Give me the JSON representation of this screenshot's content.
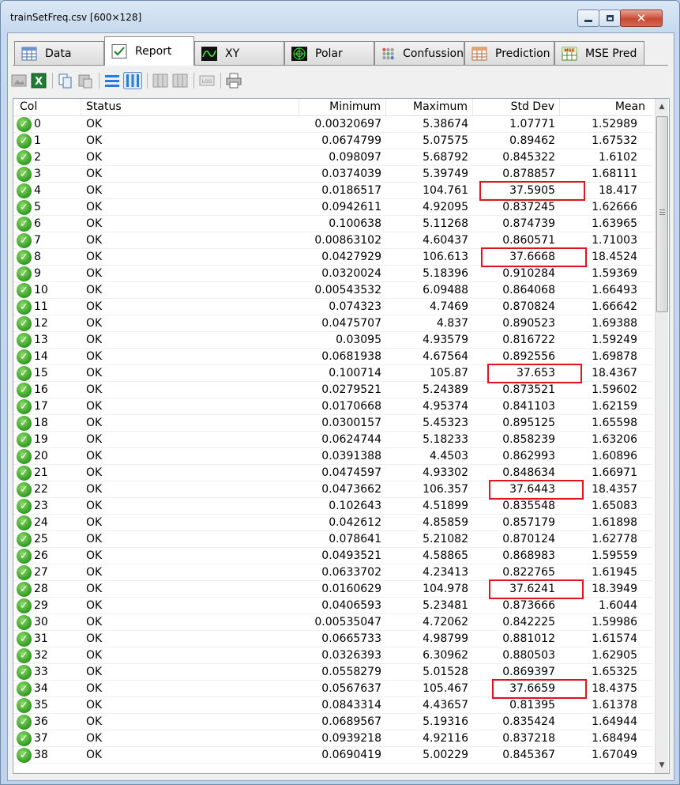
{
  "window": {
    "title": "trainSetFreq.csv [600×128]"
  },
  "tabs": [
    {
      "label": "Data",
      "icon": "data-grid-icon"
    },
    {
      "label": "Report",
      "icon": "checkbox-report-icon"
    },
    {
      "label": "XY",
      "icon": "xy-plot-icon"
    },
    {
      "label": "Polar",
      "icon": "polar-plot-icon"
    },
    {
      "label": "Confussion",
      "icon": "confusion-matrix-icon"
    },
    {
      "label": "Prediction",
      "icon": "prediction-grid-icon"
    },
    {
      "label": "MSE Pred",
      "icon": "mse-pred-icon"
    }
  ],
  "active_tab": "Report",
  "columns": {
    "col": "Col",
    "status": "Status",
    "minimum": "Minimum",
    "maximum": "Maximum",
    "std_dev": "Std Dev",
    "mean": "Mean"
  },
  "rows": [
    {
      "col": "0",
      "status": "OK",
      "min": "0.00320697",
      "max": "5.38674",
      "std": "1.07771",
      "mean": "1.52989"
    },
    {
      "col": "1",
      "status": "OK",
      "min": "0.0674799",
      "max": "5.07575",
      "std": "0.89462",
      "mean": "1.67532"
    },
    {
      "col": "2",
      "status": "OK",
      "min": "0.098097",
      "max": "5.68792",
      "std": "0.845322",
      "mean": "1.6102"
    },
    {
      "col": "3",
      "status": "OK",
      "min": "0.0374039",
      "max": "5.39749",
      "std": "0.878857",
      "mean": "1.68111"
    },
    {
      "col": "4",
      "status": "OK",
      "min": "0.0186517",
      "max": "104.761",
      "std": "37.5905",
      "mean": "18.417",
      "highlight": true
    },
    {
      "col": "5",
      "status": "OK",
      "min": "0.0942611",
      "max": "4.92095",
      "std": "0.837245",
      "mean": "1.62666"
    },
    {
      "col": "6",
      "status": "OK",
      "min": "0.100638",
      "max": "5.11268",
      "std": "0.874739",
      "mean": "1.63965"
    },
    {
      "col": "7",
      "status": "OK",
      "min": "0.00863102",
      "max": "4.60437",
      "std": "0.860571",
      "mean": "1.71003"
    },
    {
      "col": "8",
      "status": "OK",
      "min": "0.0427929",
      "max": "106.613",
      "std": "37.6668",
      "mean": "18.4524",
      "highlight": true
    },
    {
      "col": "9",
      "status": "OK",
      "min": "0.0320024",
      "max": "5.18396",
      "std": "0.910284",
      "mean": "1.59369"
    },
    {
      "col": "10",
      "status": "OK",
      "min": "0.00543532",
      "max": "6.09488",
      "std": "0.864068",
      "mean": "1.66493"
    },
    {
      "col": "11",
      "status": "OK",
      "min": "0.074323",
      "max": "4.7469",
      "std": "0.870824",
      "mean": "1.66642"
    },
    {
      "col": "12",
      "status": "OK",
      "min": "0.0475707",
      "max": "4.837",
      "std": "0.890523",
      "mean": "1.69388"
    },
    {
      "col": "13",
      "status": "OK",
      "min": "0.03095",
      "max": "4.93579",
      "std": "0.816722",
      "mean": "1.59249"
    },
    {
      "col": "14",
      "status": "OK",
      "min": "0.0681938",
      "max": "4.67564",
      "std": "0.892556",
      "mean": "1.69878"
    },
    {
      "col": "15",
      "status": "OK",
      "min": "0.100714",
      "max": "105.87",
      "std": "37.653",
      "mean": "18.4367",
      "highlight": true
    },
    {
      "col": "16",
      "status": "OK",
      "min": "0.0279521",
      "max": "5.24389",
      "std": "0.873521",
      "mean": "1.59602"
    },
    {
      "col": "17",
      "status": "OK",
      "min": "0.0170668",
      "max": "4.95374",
      "std": "0.841103",
      "mean": "1.62159"
    },
    {
      "col": "18",
      "status": "OK",
      "min": "0.0300157",
      "max": "5.45323",
      "std": "0.895125",
      "mean": "1.65598"
    },
    {
      "col": "19",
      "status": "OK",
      "min": "0.0624744",
      "max": "5.18233",
      "std": "0.858239",
      "mean": "1.63206"
    },
    {
      "col": "20",
      "status": "OK",
      "min": "0.0391388",
      "max": "4.4503",
      "std": "0.862993",
      "mean": "1.60896"
    },
    {
      "col": "21",
      "status": "OK",
      "min": "0.0474597",
      "max": "4.93302",
      "std": "0.848634",
      "mean": "1.66971"
    },
    {
      "col": "22",
      "status": "OK",
      "min": "0.0473662",
      "max": "106.357",
      "std": "37.6443",
      "mean": "18.4357",
      "highlight": true
    },
    {
      "col": "23",
      "status": "OK",
      "min": "0.102643",
      "max": "4.51899",
      "std": "0.835548",
      "mean": "1.65083"
    },
    {
      "col": "24",
      "status": "OK",
      "min": "0.042612",
      "max": "4.85859",
      "std": "0.857179",
      "mean": "1.61898"
    },
    {
      "col": "25",
      "status": "OK",
      "min": "0.078641",
      "max": "5.21082",
      "std": "0.870124",
      "mean": "1.62778"
    },
    {
      "col": "26",
      "status": "OK",
      "min": "0.0493521",
      "max": "4.58865",
      "std": "0.868983",
      "mean": "1.59559"
    },
    {
      "col": "27",
      "status": "OK",
      "min": "0.0633702",
      "max": "4.23413",
      "std": "0.822765",
      "mean": "1.61945"
    },
    {
      "col": "28",
      "status": "OK",
      "min": "0.0160629",
      "max": "104.978",
      "std": "37.6241",
      "mean": "18.3949",
      "highlight": true
    },
    {
      "col": "29",
      "status": "OK",
      "min": "0.0406593",
      "max": "5.23481",
      "std": "0.873666",
      "mean": "1.6044"
    },
    {
      "col": "30",
      "status": "OK",
      "min": "0.00535047",
      "max": "4.72062",
      "std": "0.842225",
      "mean": "1.59986"
    },
    {
      "col": "31",
      "status": "OK",
      "min": "0.0665733",
      "max": "4.98799",
      "std": "0.881012",
      "mean": "1.61574"
    },
    {
      "col": "32",
      "status": "OK",
      "min": "0.0326393",
      "max": "6.30962",
      "std": "0.880503",
      "mean": "1.62905"
    },
    {
      "col": "33",
      "status": "OK",
      "min": "0.0558279",
      "max": "5.01528",
      "std": "0.869397",
      "mean": "1.65325"
    },
    {
      "col": "34",
      "status": "OK",
      "min": "0.0567637",
      "max": "105.467",
      "std": "37.6659",
      "mean": "18.4375",
      "highlight": true
    },
    {
      "col": "35",
      "status": "OK",
      "min": "0.0843314",
      "max": "4.43657",
      "std": "0.81395",
      "mean": "1.61378"
    },
    {
      "col": "36",
      "status": "OK",
      "min": "0.0689567",
      "max": "5.19316",
      "std": "0.835424",
      "mean": "1.64944"
    },
    {
      "col": "37",
      "status": "OK",
      "min": "0.0939218",
      "max": "4.92116",
      "std": "0.837218",
      "mean": "1.68494"
    },
    {
      "col": "38",
      "status": "OK",
      "min": "0.0690419",
      "max": "5.00229",
      "std": "0.845367",
      "mean": "1.67049"
    }
  ],
  "colors": {
    "highlight_border": "#e0141c",
    "ok_green": "#2f9a21"
  }
}
